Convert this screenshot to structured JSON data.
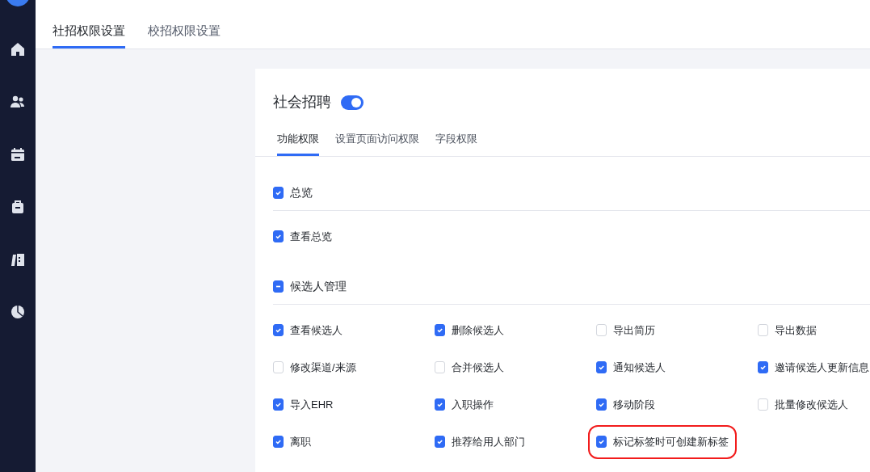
{
  "top_tabs": [
    {
      "label": "社招权限设置",
      "selected": true
    },
    {
      "label": "校招权限设置",
      "selected": false
    }
  ],
  "panel": {
    "title": "社会招聘",
    "enabled": true,
    "tabs": [
      {
        "label": "功能权限",
        "selected": true
      },
      {
        "label": "设置页面访问权限",
        "selected": false
      },
      {
        "label": "字段权限",
        "selected": false
      }
    ],
    "groups": [
      {
        "label": "总览",
        "checked": true,
        "items": [
          {
            "label": "查看总览",
            "checked": true
          }
        ]
      },
      {
        "label": "候选人管理",
        "partial": true,
        "items": [
          {
            "label": "查看候选人",
            "checked": true
          },
          {
            "label": "删除候选人",
            "checked": true
          },
          {
            "label": "导出简历",
            "checked": false
          },
          {
            "label": "导出数据",
            "checked": false
          },
          {
            "label": "修改渠道/来源",
            "checked": false
          },
          {
            "label": "合并候选人",
            "checked": false
          },
          {
            "label": "通知候选人",
            "checked": true
          },
          {
            "label": "邀请候选人更新信息",
            "checked": true
          },
          {
            "label": "导入EHR",
            "checked": true
          },
          {
            "label": "入职操作",
            "checked": true
          },
          {
            "label": "移动阶段",
            "checked": true
          },
          {
            "label": "批量修改候选人",
            "checked": false
          },
          {
            "label": "离职",
            "checked": true
          },
          {
            "label": "推荐给用人部门",
            "checked": true
          },
          {
            "label": "标记标签时可创建新标签",
            "checked": true,
            "highlighted": true
          }
        ]
      }
    ]
  }
}
